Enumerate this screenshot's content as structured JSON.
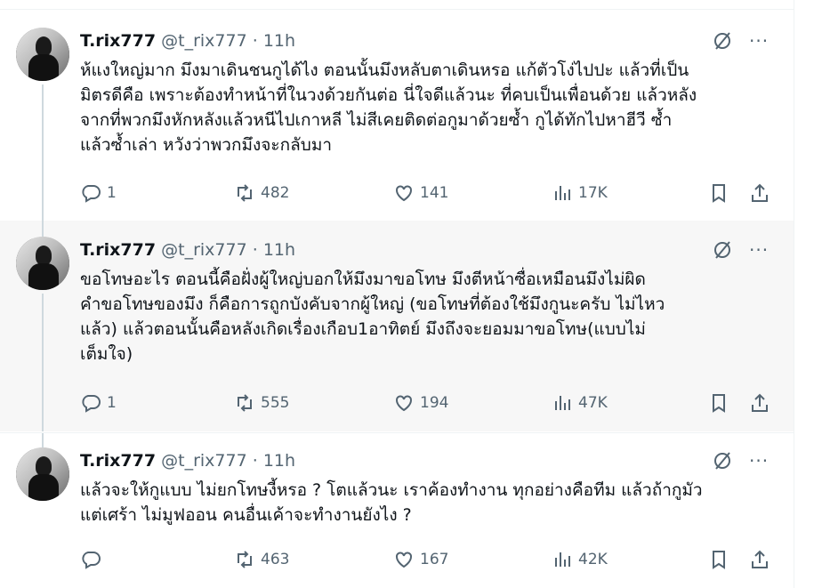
{
  "tweets": [
    {
      "name": "T.rix777",
      "handle": "@t_rix777",
      "time": "· 11h",
      "text": "ห้แงใหญ่มาก มึงมาเดินชนกูได้ไง ตอนนั้นมึงหลับตาเดินหรอ แก้ตัวโง่ไปปะ แล้วที่เป็น\nมิตรดีคือ เพราะต้องทำหน้าที่ในวงด้วยกันต่อ นี่ใจดีแล้วนะ ที่คบเป็นเพื่อนด้วย แล้วหลัง\nจากที่พวกมึงหักหลังแล้วหนีไปเกาหลี ไม่สีเคยติดต่อกูมาด้วยซ้ำ กูได้ทักไปหาฮีวี ซ้ำ\nแล้วซ้ำเล่า หวังว่าพวกมึงจะกลับมา",
      "replies": "1",
      "reposts": "482",
      "likes": "141",
      "views": "17K"
    },
    {
      "name": "T.rix777",
      "handle": "@t_rix777",
      "time": "· 11h",
      "text": "ขอโทษอะไร ตอนนี้คือฝั่งผู้ใหญ่บอกให้มึงมาขอโทษ มึงตีหน้าซื่อเหมือนมึงไม่ผิด\nคำขอโทษของมึง ก็คือการถูกบังคับจากผู้ใหญ่ (ขอโทษที่ต้องใช้มึงกูนะครับ ไม่ไหว\nแล้ว) แล้วตอนนั้นคือหลังเกิดเรื่องเกือบ1อาทิตย์ มึงถึงจะยอมมาขอโทษ(แบบไม่\nเต็มใจ)",
      "replies": "1",
      "reposts": "555",
      "likes": "194",
      "views": "47K"
    },
    {
      "name": "T.rix777",
      "handle": "@t_rix777",
      "time": "· 11h",
      "text": "แล้วจะให้กูแบบ ไม่ยกโทษงี้หรอ ? โตแล้วนะ เราค้องทำงาน ทุกอย่างคือทีม แล้วถ้ากูมัว\nแต่เศร้า ไม่มูฟออน คนอื่นเค้าจะทำงานยังไง ?",
      "replies": "",
      "reposts": "463",
      "likes": "167",
      "views": "42K"
    }
  ],
  "more_label": "···",
  "icons": {
    "reply": "reply-icon",
    "repost": "repost-icon",
    "like": "heart-icon",
    "views": "views-icon",
    "bookmark": "bookmark-icon",
    "share": "share-icon",
    "grok": "grok-icon",
    "more": "more-icon"
  }
}
